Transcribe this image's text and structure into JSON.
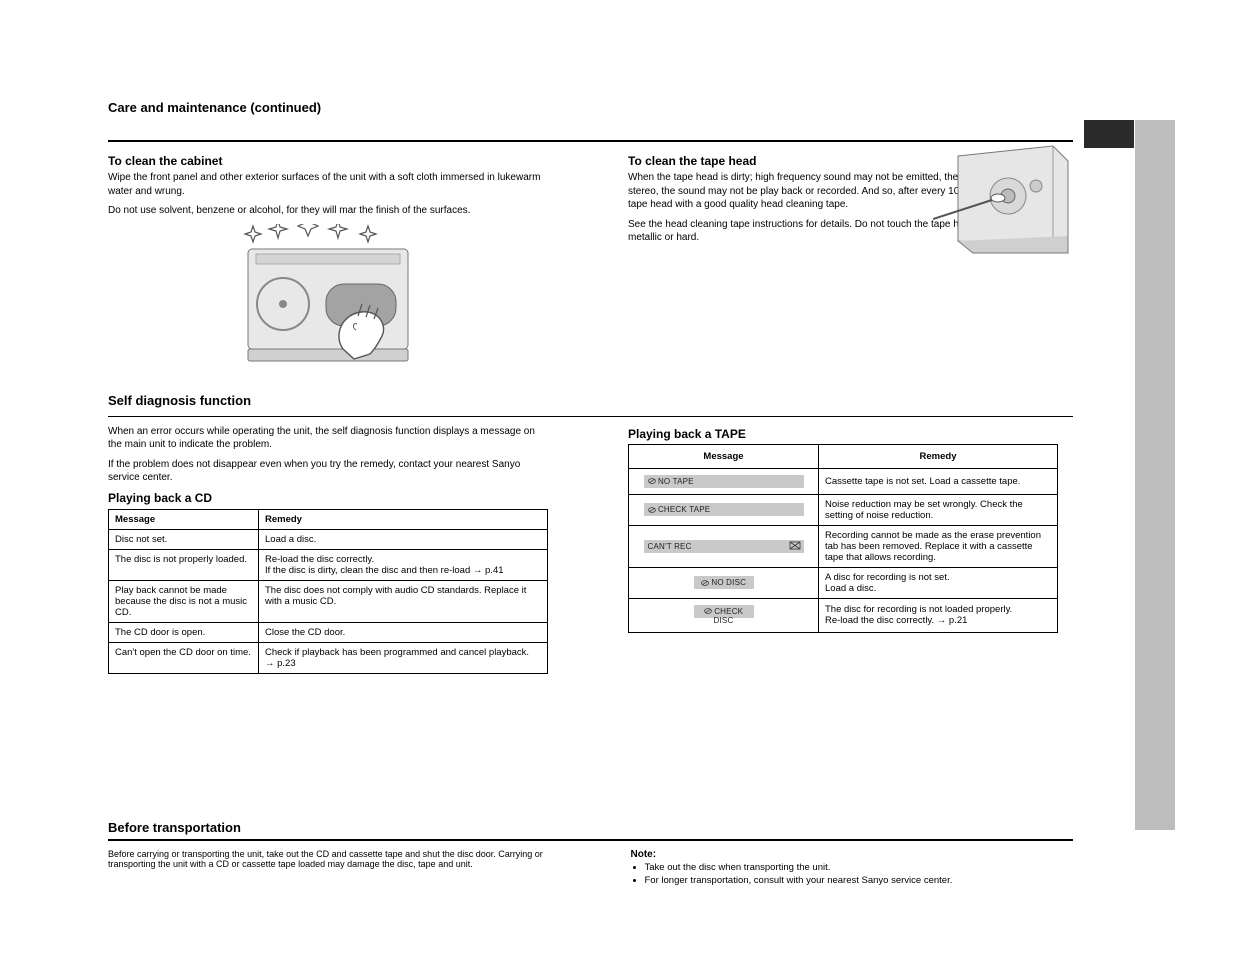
{
  "section_care_title": "Care and maintenance (continued)",
  "cabinet": {
    "heading": "To clean the cabinet",
    "p1": "Wipe the front panel and other exterior surfaces of the unit with a soft cloth immersed in lukewarm water and wrung.",
    "p2": "Do not use solvent, benzene or alcohol, for they will mar the finish of the surfaces."
  },
  "tapehead": {
    "heading": "To clean the tape head",
    "p1": "When the tape head is dirty; high frequency sound may not be emitted, the sound may not be in stereo, the sound may not be play back or recorded. And so, after every 10 hours of use, clean the tape head with a good quality head cleaning tape.",
    "p2": "See the head cleaning tape instructions for details. Do not touch the tape head with anything metallic or hard."
  },
  "section_self_title": "Self diagnosis function",
  "self_intro": "When an error occurs while operating the unit, the self diagnosis function displays a message on the main unit to indicate the problem.",
  "self_note": "If the problem does not disappear even when you try the remedy, contact your nearest Sanyo service center.",
  "cd_tbl_heading": "Playing back a CD",
  "cd_header_msg": "Message",
  "cd_header_rem": "Remedy",
  "cd_rows": [
    {
      "msg": "Disc not set.",
      "rem": "Load a disc."
    },
    {
      "msg": "The disc is not properly loaded.",
      "rem": "Re-load the disc correctly.\nIf the disc is dirty, clean the disc and then re-load → p.41"
    },
    {
      "msg": "Play back cannot be made because the disc is not a music CD.",
      "rem": "The disc does not comply with audio CD standards. Replace it with a music CD."
    },
    {
      "msg": "The CD door is open.",
      "rem": "Close the CD door."
    },
    {
      "msg": "Can't open the CD door on time.",
      "rem": "Check if playback has been programmed and cancel playback. → p.23"
    }
  ],
  "tape_tbl_heading": "Playing back a TAPE",
  "tape_header_msg": "Message",
  "tape_header_rem": "Remedy",
  "tape_rows": [
    {
      "msg": "NO TAPE",
      "rem": "Cassette tape is not set. Load a cassette tape."
    },
    {
      "msg": "CHECK TAPE",
      "rem": "Noise reduction may be set wrongly. Check the setting of noise reduction."
    },
    {
      "msg": "CAN'T REC",
      "mini": true,
      "rem": "Recording cannot be made as the erase prevention tab has been removed. Replace it with a cassette tape that allows recording."
    },
    {
      "msg": "NO DISC",
      "short": true,
      "rem": "A disc for recording is not set.\nLoad a disc."
    },
    {
      "msg": "CHECK DISC",
      "short": true,
      "rem": "The disc for recording is not loaded properly.\nRe-load the disc correctly. → p.21"
    }
  ],
  "footer": {
    "title": "Before transportation",
    "col1": "Before carrying or transporting the unit, take out the CD and cassette tape and shut the disc door. Carrying or transporting the unit with a CD or cassette tape loaded may damage the disc, tape and unit.",
    "col2_heading": "Note:",
    "col2_items": [
      "Take out the disc when transporting the unit.",
      "For longer transportation, consult with your nearest Sanyo service center."
    ]
  }
}
